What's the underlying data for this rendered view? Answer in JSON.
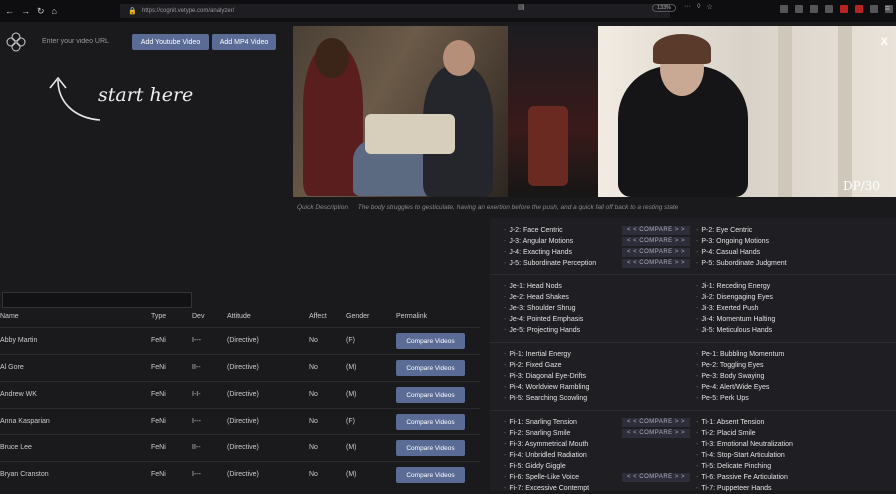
{
  "browser": {
    "url": "https://cognit.vetype.com/analyzer/",
    "zoom": "133%"
  },
  "input": {
    "placeholder": "Enter your video URL"
  },
  "buttons": {
    "add_youtube": "Add Youtube Video",
    "add_mp4": "Add MP4 Video"
  },
  "start_here": "start here",
  "video": {
    "close": "X",
    "watermark": "DP/30"
  },
  "quick_description": {
    "label": "Quick Description",
    "text": "The body struggles to gesticulate, having an exertion before the push, and a quick fall off back to a resting state"
  },
  "table": {
    "headers": {
      "name": "Name",
      "type": "Type",
      "dev": "Dev",
      "attitude": "Attitude",
      "affect": "Affect",
      "gender": "Gender",
      "permalink": "Permalink"
    },
    "compare_label": "Compare Videos",
    "rows": [
      {
        "name": "Abby Martin",
        "type": "FeNi",
        "dev": "I---",
        "attitude": "(Directive)",
        "affect": "No",
        "gender": "(F)"
      },
      {
        "name": "Al Gore",
        "type": "FeNi",
        "dev": "II--",
        "attitude": "(Directive)",
        "affect": "No",
        "gender": "(M)"
      },
      {
        "name": "Andrew WK",
        "type": "FeNi",
        "dev": "I-I-",
        "attitude": "(Directive)",
        "affect": "No",
        "gender": "(M)"
      },
      {
        "name": "Anna Kasparian",
        "type": "FeNi",
        "dev": "I---",
        "attitude": "(Directive)",
        "affect": "No",
        "gender": "(F)"
      },
      {
        "name": "Bruce Lee",
        "type": "FeNi",
        "dev": "II--",
        "attitude": "(Directive)",
        "affect": "No",
        "gender": "(M)"
      },
      {
        "name": "Bryan Cranston",
        "type": "FeNi",
        "dev": "I---",
        "attitude": "(Directive)",
        "affect": "No",
        "gender": "(M)"
      }
    ]
  },
  "compare_tag": "< < COMPARE > >",
  "groups": [
    {
      "left": [
        {
          "label": "J-2: Face Centric",
          "compare": true
        },
        {
          "label": "J-3: Angular Motions",
          "compare": true
        },
        {
          "label": "J-4: Exacting Hands",
          "compare": true
        },
        {
          "label": "J-5: Subordinate Perception",
          "compare": true
        }
      ],
      "right": [
        "P-2: Eye Centric",
        "P-3: Ongoing Motions",
        "P-4: Casual Hands",
        "P-5: Subordinate Judgment"
      ]
    },
    {
      "left": [
        {
          "label": "Je-1: Head Nods"
        },
        {
          "label": "Je-2: Head Shakes"
        },
        {
          "label": "Je-3: Shoulder Shrug"
        },
        {
          "label": "Je-4: Pointed Emphasis"
        },
        {
          "label": "Je-5: Projecting Hands"
        }
      ],
      "right": [
        "Ji-1: Receding Energy",
        "Ji-2: Disengaging Eyes",
        "Ji-3: Exerted Push",
        "Ji-4: Momentum Halting",
        "Ji-5: Meticulous Hands"
      ]
    },
    {
      "left": [
        {
          "label": "Pi-1: Inertial Energy"
        },
        {
          "label": "Pi-2: Fixed Gaze"
        },
        {
          "label": "Pi-3: Diagonal Eye-Drifts"
        },
        {
          "label": "Pi-4: Worldview Rambling"
        },
        {
          "label": "Pi-5: Searching Scowling"
        }
      ],
      "right": [
        "Pe-1: Bubbling Momentum",
        "Pe-2: Toggling Eyes",
        "Pe-3: Body Swaying",
        "Pe-4: Alert/Wide Eyes",
        "Pe-5: Perk Ups"
      ]
    },
    {
      "left": [
        {
          "label": "Fi-1: Snarling Tension",
          "compare": true
        },
        {
          "label": "Fi-2: Snarling Smile",
          "compare": true
        },
        {
          "label": "Fi-3: Asymmetrical Mouth"
        },
        {
          "label": "Fi-4: Unbridled Radiation"
        },
        {
          "label": "Fi-5: Giddy Giggle"
        },
        {
          "label": "Fi-6: Spelle-Like Voice",
          "compare": true
        },
        {
          "label": "Fi-7: Excessive Contempt"
        }
      ],
      "right": [
        "Ti-1: Absent Tension",
        "Ti-2: Placid Smile",
        "Ti-3: Emotional Neutralization",
        "Ti-4: Stop-Start Articulation",
        "Ti-5: Delicate Pinching",
        "Ti-6: Passive Fe Articulation",
        "Ti-7: Puppeteer Hands"
      ]
    }
  ]
}
